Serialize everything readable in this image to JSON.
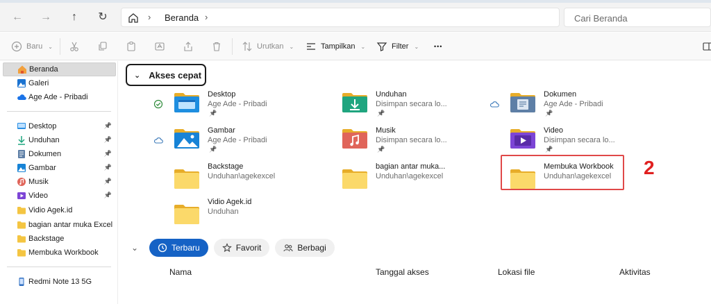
{
  "address_bar": {
    "breadcrumb": "Beranda"
  },
  "search": {
    "placeholder": "Cari Beranda"
  },
  "toolbar": {
    "new_label": "Baru",
    "sort_label": "Urutkan",
    "view_label": "Tampilkan",
    "filter_label": "Filter",
    "more_label": "•••"
  },
  "sidebar": {
    "items": [
      {
        "label": "Beranda",
        "icon": "home-icon",
        "pinned": false
      },
      {
        "label": "Galeri",
        "icon": "gallery-icon",
        "pinned": false
      },
      {
        "label": "Age Ade - Pribadi",
        "icon": "onedrive-icon",
        "pinned": false
      },
      {
        "label": "Desktop",
        "icon": "desktop-icon",
        "pinned": true
      },
      {
        "label": "Unduhan",
        "icon": "download-icon",
        "pinned": true
      },
      {
        "label": "Dokumen",
        "icon": "documents-icon",
        "pinned": true
      },
      {
        "label": "Gambar",
        "icon": "pictures-icon",
        "pinned": true
      },
      {
        "label": "Musik",
        "icon": "music-icon",
        "pinned": true
      },
      {
        "label": "Video",
        "icon": "video-icon",
        "pinned": true
      },
      {
        "label": "Vidio Agek.id",
        "icon": "folder-icon",
        "pinned": false
      },
      {
        "label": "bagian antar muka Excel",
        "icon": "folder-icon",
        "pinned": false
      },
      {
        "label": "Backstage",
        "icon": "folder-icon",
        "pinned": false
      },
      {
        "label": "Membuka Workbook",
        "icon": "folder-icon",
        "pinned": false
      },
      {
        "label": "Redmi Note 13 5G",
        "icon": "phone-icon",
        "pinned": false
      }
    ]
  },
  "quick_access": {
    "title": "Akses cepat",
    "items": [
      {
        "name": "Desktop",
        "location": "Age Ade - Pribadi",
        "pinned": true,
        "status": "synced"
      },
      {
        "name": "Unduhan",
        "location": "Disimpan secara lo...",
        "pinned": true,
        "status": ""
      },
      {
        "name": "Dokumen",
        "location": "Age Ade - Pribadi",
        "pinned": true,
        "status": "cloud"
      },
      {
        "name": "Gambar",
        "location": "Age Ade - Pribadi",
        "pinned": true,
        "status": "cloud"
      },
      {
        "name": "Musik",
        "location": "Disimpan secara lo...",
        "pinned": true,
        "status": ""
      },
      {
        "name": "Video",
        "location": "Disimpan secara lo...",
        "pinned": true,
        "status": ""
      },
      {
        "name": "Backstage",
        "location": "Unduhan\\agekexcel",
        "pinned": false,
        "status": ""
      },
      {
        "name": "bagian antar muka...",
        "location": "Unduhan\\agekexcel",
        "pinned": false,
        "status": ""
      },
      {
        "name": "Membuka Workbook",
        "location": "Unduhan\\agekexcel",
        "pinned": false,
        "status": ""
      },
      {
        "name": "Vidio Agek.id",
        "location": "Unduhan",
        "pinned": false,
        "status": ""
      }
    ]
  },
  "annotation": {
    "label": "2",
    "color": "#e02020"
  },
  "recent_tabs": [
    "Terbaru",
    "Favorit",
    "Berbagi"
  ],
  "columns": [
    "Nama",
    "Tanggal akses",
    "Lokasi file",
    "Aktivitas"
  ],
  "colors": {
    "accent": "#1562c5",
    "folder": "#f4c542",
    "highlight": "#e04848"
  }
}
